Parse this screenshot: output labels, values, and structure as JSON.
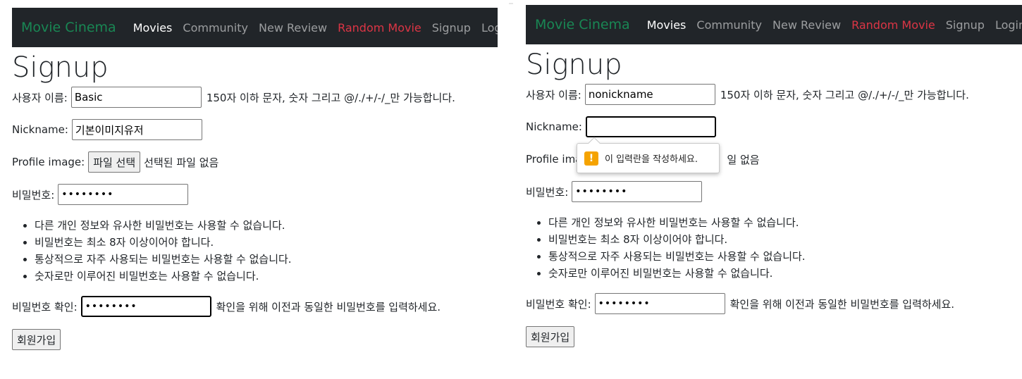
{
  "nav": {
    "brand": "Movie Cinema",
    "items": [
      "Movies",
      "Community",
      "New Review",
      "Random Movie",
      "Signup",
      "Login"
    ]
  },
  "colors": {
    "brand": "#198754",
    "danger": "#dc3545",
    "navbar": "#212529"
  },
  "form": {
    "title": "Signup",
    "username_label": "사용자 이름:",
    "username_help": "150자 이하 문자, 숫자 그리고 @/./+/-/_만 가능합니다.",
    "nickname_label": "Nickname:",
    "profile_label": "Profile image:",
    "file_button": "파일 선택",
    "file_status": "선택된 파일 없음",
    "password_label": "비밀번호:",
    "password_rules": [
      "다른 개인 정보와 유사한 비밀번호는 사용할 수 없습니다.",
      "비밀번호는 최소 8자 이상이어야 합니다.",
      "통상적으로 자주 사용되는 비밀번호는 사용할 수 없습니다.",
      "숫자로만 이루어진 비밀번호는 사용할 수 없습니다."
    ],
    "confirm_label": "비밀번호 확인:",
    "confirm_help": "확인을 위해 이전과 동일한 비밀번호를 입력하세요.",
    "submit_label": "회원가입"
  },
  "left": {
    "username_value": "Basic",
    "nickname_value": "기본이미지유저",
    "password_value": "••••••••",
    "confirm_value": "••••••••"
  },
  "right": {
    "username_value": "nonickname",
    "nickname_value": "",
    "password_value": "••••••••",
    "confirm_value": "••••••••",
    "file_status_visible": "일 없음",
    "profile_label_visible": "Profile ima",
    "validation_message": "이 입력란을 작성하세요.",
    "validation_icon": "warning-icon"
  }
}
